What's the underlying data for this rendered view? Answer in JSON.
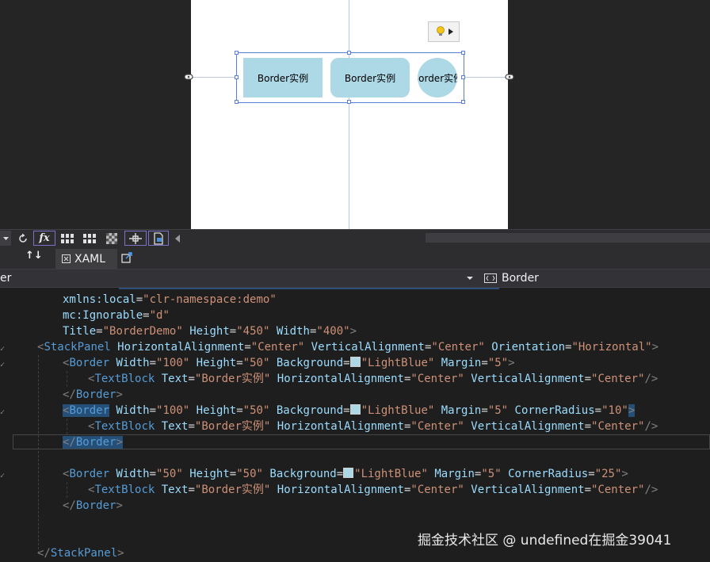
{
  "designer": {
    "borders": [
      {
        "text": "Border实例"
      },
      {
        "text": "Border实例"
      },
      {
        "text": "Border实例"
      }
    ]
  },
  "toolbar": {
    "fx_label": "fx"
  },
  "tabs": {
    "sort_icon": "↑↓",
    "xaml_label": "XAML"
  },
  "nav": {
    "left_text": "er",
    "right_text": "Border"
  },
  "code": {
    "lines": [
      {
        "kind": "attr",
        "indent": "      ",
        "attr": "xmlns:local",
        "val": "clr-namespace:demo"
      },
      {
        "kind": "attr",
        "indent": "      ",
        "attr": "mc:Ignorable",
        "val": "d"
      },
      {
        "kind": "attr3",
        "indent": "      ",
        "a1": "Title",
        "v1": "BorderDemo",
        "a2": "Height",
        "v2": "450",
        "a3": "Width",
        "v3": "400",
        "close": ">"
      }
    ],
    "stackpanel_open": {
      "tag": "StackPanel",
      "a1": "HorizontalAlignment",
      "v1": "Center",
      "a2": "VerticalAlignment",
      "v2": "Center",
      "a3": "Orientation",
      "v3": "Horizontal"
    },
    "border1": {
      "tag": "Border",
      "w": "100",
      "h": "50",
      "bg": "LightBlue",
      "margin": "5"
    },
    "textblock": {
      "tag": "TextBlock",
      "text": "Border实例",
      "ha": "Center",
      "va": "Center"
    },
    "border_close": "Border",
    "border2": {
      "tag": "Border",
      "w": "100",
      "h": "50",
      "bg": "LightBlue",
      "margin": "5",
      "cr": "10"
    },
    "border3": {
      "tag": "Border",
      "w": "50",
      "h": "50",
      "bg": "LightBlue",
      "margin": "5",
      "cr": "25"
    },
    "stackpanel_close": "StackPanel"
  },
  "watermark": "掘金技术社区 @ undefined在掘金39041",
  "colors": {
    "light_blue": "#add8e6",
    "editor_bg": "#1e1e1e",
    "selection": "#5a7fd6"
  }
}
